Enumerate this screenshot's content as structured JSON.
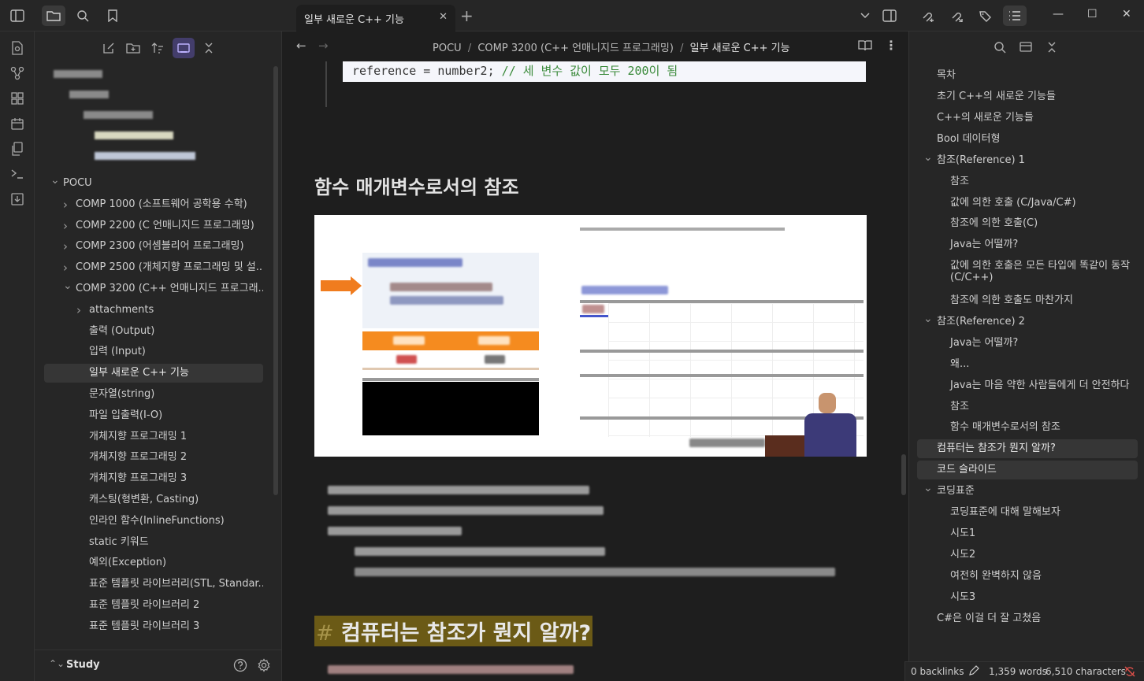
{
  "tab": {
    "title": "일부 새로운 C++ 기능"
  },
  "breadcrumb": [
    "POCU",
    "COMP 3200 (C++ 언매니지드 프로그래밍)",
    "일부 새로운 C++ 기능"
  ],
  "breadcrumb_sep": "/",
  "sidebar": {
    "tree": [
      {
        "label": "POCU",
        "indent": 0
      },
      {
        "label": "COMP 1000 (소프트웨어 공학용 수학)",
        "indent": 1
      },
      {
        "label": "COMP 2200 (C 언매니지드 프로그래밍)",
        "indent": 1
      },
      {
        "label": "COMP 2300 (어셈블리어 프로그래밍)",
        "indent": 1
      },
      {
        "label": "COMP 2500 (개체지향 프로그래밍 및 설...",
        "indent": 1
      },
      {
        "label": "COMP 3200 (C++ 언매니지드 프로그래...",
        "indent": 1
      },
      {
        "label": "attachments",
        "indent": 2
      },
      {
        "label": "출력 (Output)",
        "indent": 2
      },
      {
        "label": "입력 (Input)",
        "indent": 2
      },
      {
        "label": "일부 새로운 C++ 기능",
        "indent": 2
      },
      {
        "label": "문자열(string)",
        "indent": 2
      },
      {
        "label": "파일 입출력(I-O)",
        "indent": 2
      },
      {
        "label": "개체지향 프로그래밍 1",
        "indent": 2
      },
      {
        "label": "개체지향 프로그래밍 2",
        "indent": 2
      },
      {
        "label": "개체지향 프로그래밍 3",
        "indent": 2
      },
      {
        "label": "캐스팅(형변환, Casting)",
        "indent": 2
      },
      {
        "label": "인라인 함수(InlineFunctions)",
        "indent": 2
      },
      {
        "label": "static 키워드",
        "indent": 2
      },
      {
        "label": "예외(Exception)",
        "indent": 2
      },
      {
        "label": "표준 템플릿 라이브러리(STL, Standar...",
        "indent": 2
      },
      {
        "label": "표준 템플릿 라이브러리 2",
        "indent": 2
      },
      {
        "label": "표준 템플릿 라이브러리 3",
        "indent": 2
      }
    ],
    "vault_name": "Study"
  },
  "content": {
    "code_line": "reference = number2;",
    "code_comment": "// 세 변수 값이 모두 200이 됨",
    "heading2": "함수 매개변수로서의 참조",
    "heading1_hash": "#",
    "heading1": "컴퓨터는 참조가 뭔지 알까?"
  },
  "outline": [
    {
      "label": "목차",
      "indent": 0
    },
    {
      "label": "초기 C++의 새로운 기능들",
      "indent": 0
    },
    {
      "label": "C++의 새로운 기능들",
      "indent": 0
    },
    {
      "label": "Bool 데이터형",
      "indent": 0
    },
    {
      "label": "참조(Reference) 1",
      "indent": 0
    },
    {
      "label": "참조",
      "indent": 1
    },
    {
      "label": "값에 의한 호출 (C/Java/C#)",
      "indent": 1
    },
    {
      "label": "참조에 의한 호출(C)",
      "indent": 1
    },
    {
      "label": "Java는 어떨까?",
      "indent": 1
    },
    {
      "label": "값에 의한 호출은 모든 타입에 똑같이 동작",
      "indent": 1
    },
    {
      "label": "(C/C++)",
      "indent": 1
    },
    {
      "label": "참조에 의한 호출도 마찬가지",
      "indent": 1
    },
    {
      "label": "참조(Reference) 2",
      "indent": 0
    },
    {
      "label": "Java는 어떨까?",
      "indent": 1
    },
    {
      "label": "왜...",
      "indent": 1
    },
    {
      "label": "Java는 마음 약한 사람들에게 더 안전하다",
      "indent": 1
    },
    {
      "label": "참조",
      "indent": 1
    },
    {
      "label": "함수 매개변수로서의 참조",
      "indent": 1
    },
    {
      "label": "컴퓨터는 참조가 뭔지 알까?",
      "indent": 0
    },
    {
      "label": "코드 슬라이드",
      "indent": 0
    },
    {
      "label": "코딩표준",
      "indent": 0
    },
    {
      "label": "코딩표준에 대해 말해보자",
      "indent": 1
    },
    {
      "label": "시도1",
      "indent": 1
    },
    {
      "label": "시도2",
      "indent": 1
    },
    {
      "label": "여전히 완벽하지 않음",
      "indent": 1
    },
    {
      "label": "시도3",
      "indent": 1
    },
    {
      "label": "C#은 이걸 더 잘 고쳤음",
      "indent": 0
    }
  ],
  "status": {
    "backlinks": "0 backlinks",
    "words": "1,359 words",
    "characters": "6,510 characters"
  },
  "colors": {
    "accent": "#7c6cff",
    "highlight": "#6b5a16",
    "bg": "#1e1e1e",
    "panel": "#262626"
  }
}
